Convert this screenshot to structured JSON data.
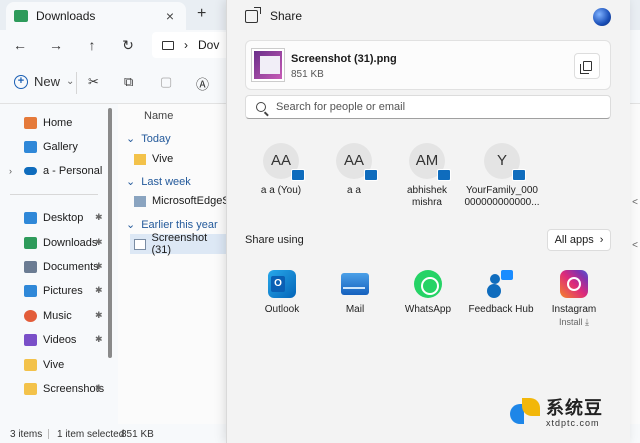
{
  "explorer": {
    "tab_title": "Downloads",
    "tab_close": "×",
    "new_tab": "+",
    "nav": {
      "back": "←",
      "forward": "→",
      "up": "↑",
      "refresh": "↻"
    },
    "address_text": "Dov",
    "toolbar": {
      "new_label": "New",
      "new_chevron": "⌄"
    },
    "sidebar": {
      "items": [
        {
          "label": "Home",
          "icon": "home-icon",
          "color": "#e57a3a"
        },
        {
          "label": "Gallery",
          "icon": "gallery-icon",
          "color": "#2f88d8"
        },
        {
          "label": "a - Personal",
          "icon": "onedrive-icon",
          "color": "#0f6cbd"
        },
        {
          "label": "Desktop",
          "icon": "desktop-icon",
          "color": "#2f88d8"
        },
        {
          "label": "Downloads",
          "icon": "downloads-icon",
          "color": "#2e9b5b"
        },
        {
          "label": "Documents",
          "icon": "documents-icon",
          "color": "#6b7c93"
        },
        {
          "label": "Pictures",
          "icon": "pictures-icon",
          "color": "#2f88d8"
        },
        {
          "label": "Music",
          "icon": "music-icon",
          "color": "#e35d3a"
        },
        {
          "label": "Videos",
          "icon": "videos-icon",
          "color": "#7a4fc8"
        },
        {
          "label": "Vive",
          "icon": "folder-icon",
          "color": "#f3c24a"
        },
        {
          "label": "Screenshots",
          "icon": "folder-icon",
          "color": "#f3c24a"
        }
      ],
      "pin_glyph": "📌",
      "expander": "›"
    },
    "content": {
      "column_name": "Name",
      "groups": [
        {
          "label": "Today",
          "files": [
            {
              "name": "Vive"
            }
          ]
        },
        {
          "label": "Last week",
          "files": [
            {
              "name": "MicrosoftEdgeSetu"
            }
          ]
        },
        {
          "label": "Earlier this year",
          "files": [
            {
              "name": "Screenshot (31)"
            }
          ]
        }
      ],
      "group_chevron": "⌄",
      "right_edge_text": "<"
    },
    "status": {
      "items": "3 items",
      "selected": "1 item selected",
      "size": "851 KB"
    }
  },
  "share": {
    "title": "Share",
    "file": {
      "name": "Screenshot (31).png",
      "size": "851 KB"
    },
    "search_placeholder": "Search for people or email",
    "people": [
      {
        "initials": "AA",
        "name": "a a (You)"
      },
      {
        "initials": "AA",
        "name": "a a"
      },
      {
        "initials": "AM",
        "name": "abhishek mishra"
      },
      {
        "initials": "Y",
        "name": "YourFamily_000 000000000000..."
      }
    ],
    "share_using_label": "Share using",
    "all_apps_label": "All apps",
    "all_apps_chevron": "›",
    "apps": [
      {
        "name": "Outlook",
        "sub": ""
      },
      {
        "name": "Mail",
        "sub": ""
      },
      {
        "name": "WhatsApp",
        "sub": ""
      },
      {
        "name": "Feedback Hub",
        "sub": ""
      },
      {
        "name": "Instagram",
        "sub": "Install ⤓"
      }
    ]
  },
  "watermark": {
    "line1": "系统豆",
    "line2": "xtdptc.com"
  }
}
